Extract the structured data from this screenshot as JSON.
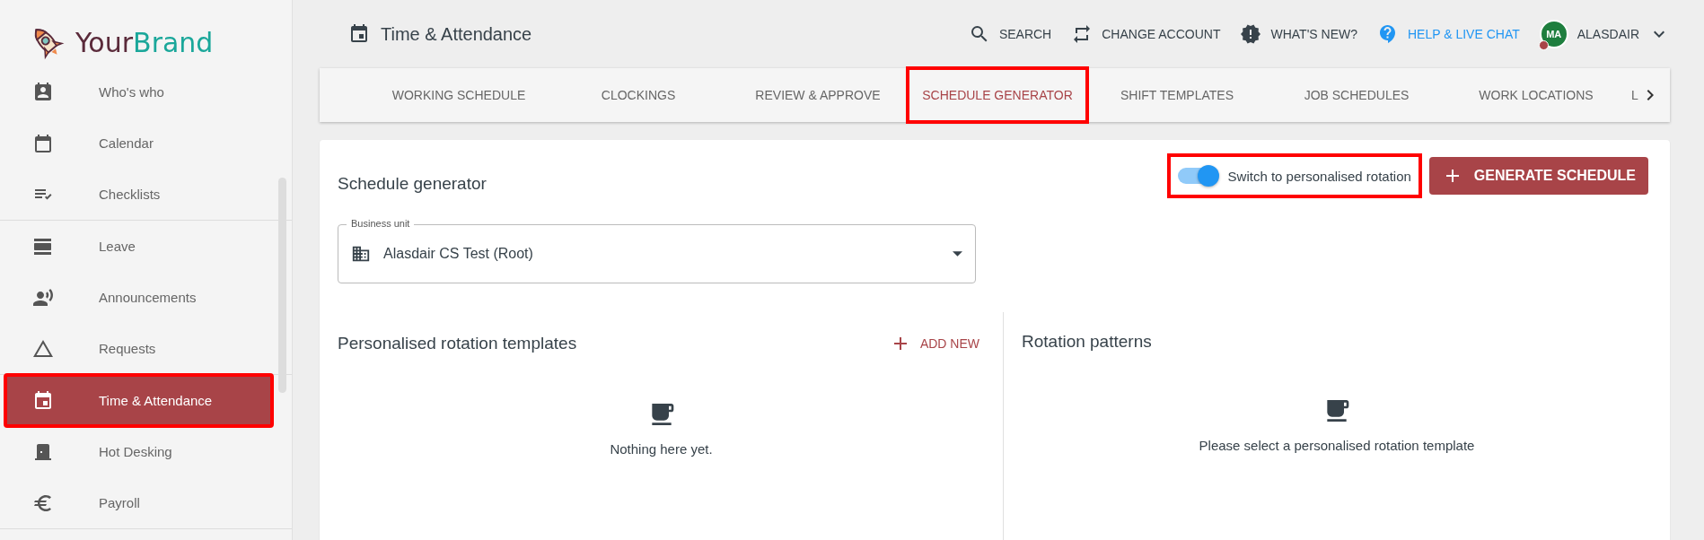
{
  "brand": {
    "text_1": "Your",
    "text_2": "Brand"
  },
  "sidebar": {
    "sections": [
      [
        {
          "label": "Who's who",
          "selected": false,
          "highlighted": false
        },
        {
          "label": "Calendar",
          "selected": false,
          "highlighted": false
        },
        {
          "label": "Checklists",
          "selected": false,
          "highlighted": false
        }
      ],
      [
        {
          "label": "Leave",
          "selected": false,
          "highlighted": false
        },
        {
          "label": "Announcements",
          "selected": false,
          "highlighted": false
        },
        {
          "label": "Requests",
          "selected": false,
          "highlighted": false
        }
      ],
      [
        {
          "label": "Time & Attendance",
          "selected": true,
          "highlighted": true
        },
        {
          "label": "Hot Desking",
          "selected": false,
          "highlighted": false
        },
        {
          "label": "Payroll",
          "selected": false,
          "highlighted": false
        }
      ]
    ]
  },
  "page_title": "Time & Attendance",
  "header_actions": [
    {
      "label": "SEARCH",
      "kind": "action"
    },
    {
      "label": "CHANGE ACCOUNT",
      "kind": "action"
    },
    {
      "label": "WHAT'S NEW?",
      "kind": "action"
    },
    {
      "label": "HELP & LIVE CHAT",
      "kind": "link"
    }
  ],
  "user": {
    "initials": "MA",
    "name": "ALASDAIR"
  },
  "tabs": [
    {
      "label": "WORKING SCHEDULE",
      "selected": false,
      "highlighted": false
    },
    {
      "label": "CLOCKINGS",
      "selected": false,
      "highlighted": false
    },
    {
      "label": "REVIEW & APPROVE",
      "selected": false,
      "highlighted": false
    },
    {
      "label": "SCHEDULE GENERATOR",
      "selected": true,
      "highlighted": true
    },
    {
      "label": "SHIFT TEMPLATES",
      "selected": false,
      "highlighted": false
    },
    {
      "label": "JOB SCHEDULES",
      "selected": false,
      "highlighted": false
    },
    {
      "label": "WORK LOCATIONS",
      "selected": false,
      "highlighted": false
    },
    {
      "label": "L",
      "selected": false,
      "highlighted": false
    }
  ],
  "card": {
    "title": "Schedule generator",
    "toggle": {
      "label": "Switch to personalised rotation",
      "on": true,
      "highlighted": true
    },
    "primary_button": "GENERATE SCHEDULE",
    "business_unit": {
      "label": "Business unit",
      "value": "Alasdair CS Test (Root)"
    },
    "panels": [
      {
        "title": "Personalised rotation templates",
        "action": "ADD NEW",
        "empty_text": "Nothing here yet."
      },
      {
        "title": "Rotation patterns",
        "empty_text": "Please select a personalised rotation template"
      }
    ]
  }
}
